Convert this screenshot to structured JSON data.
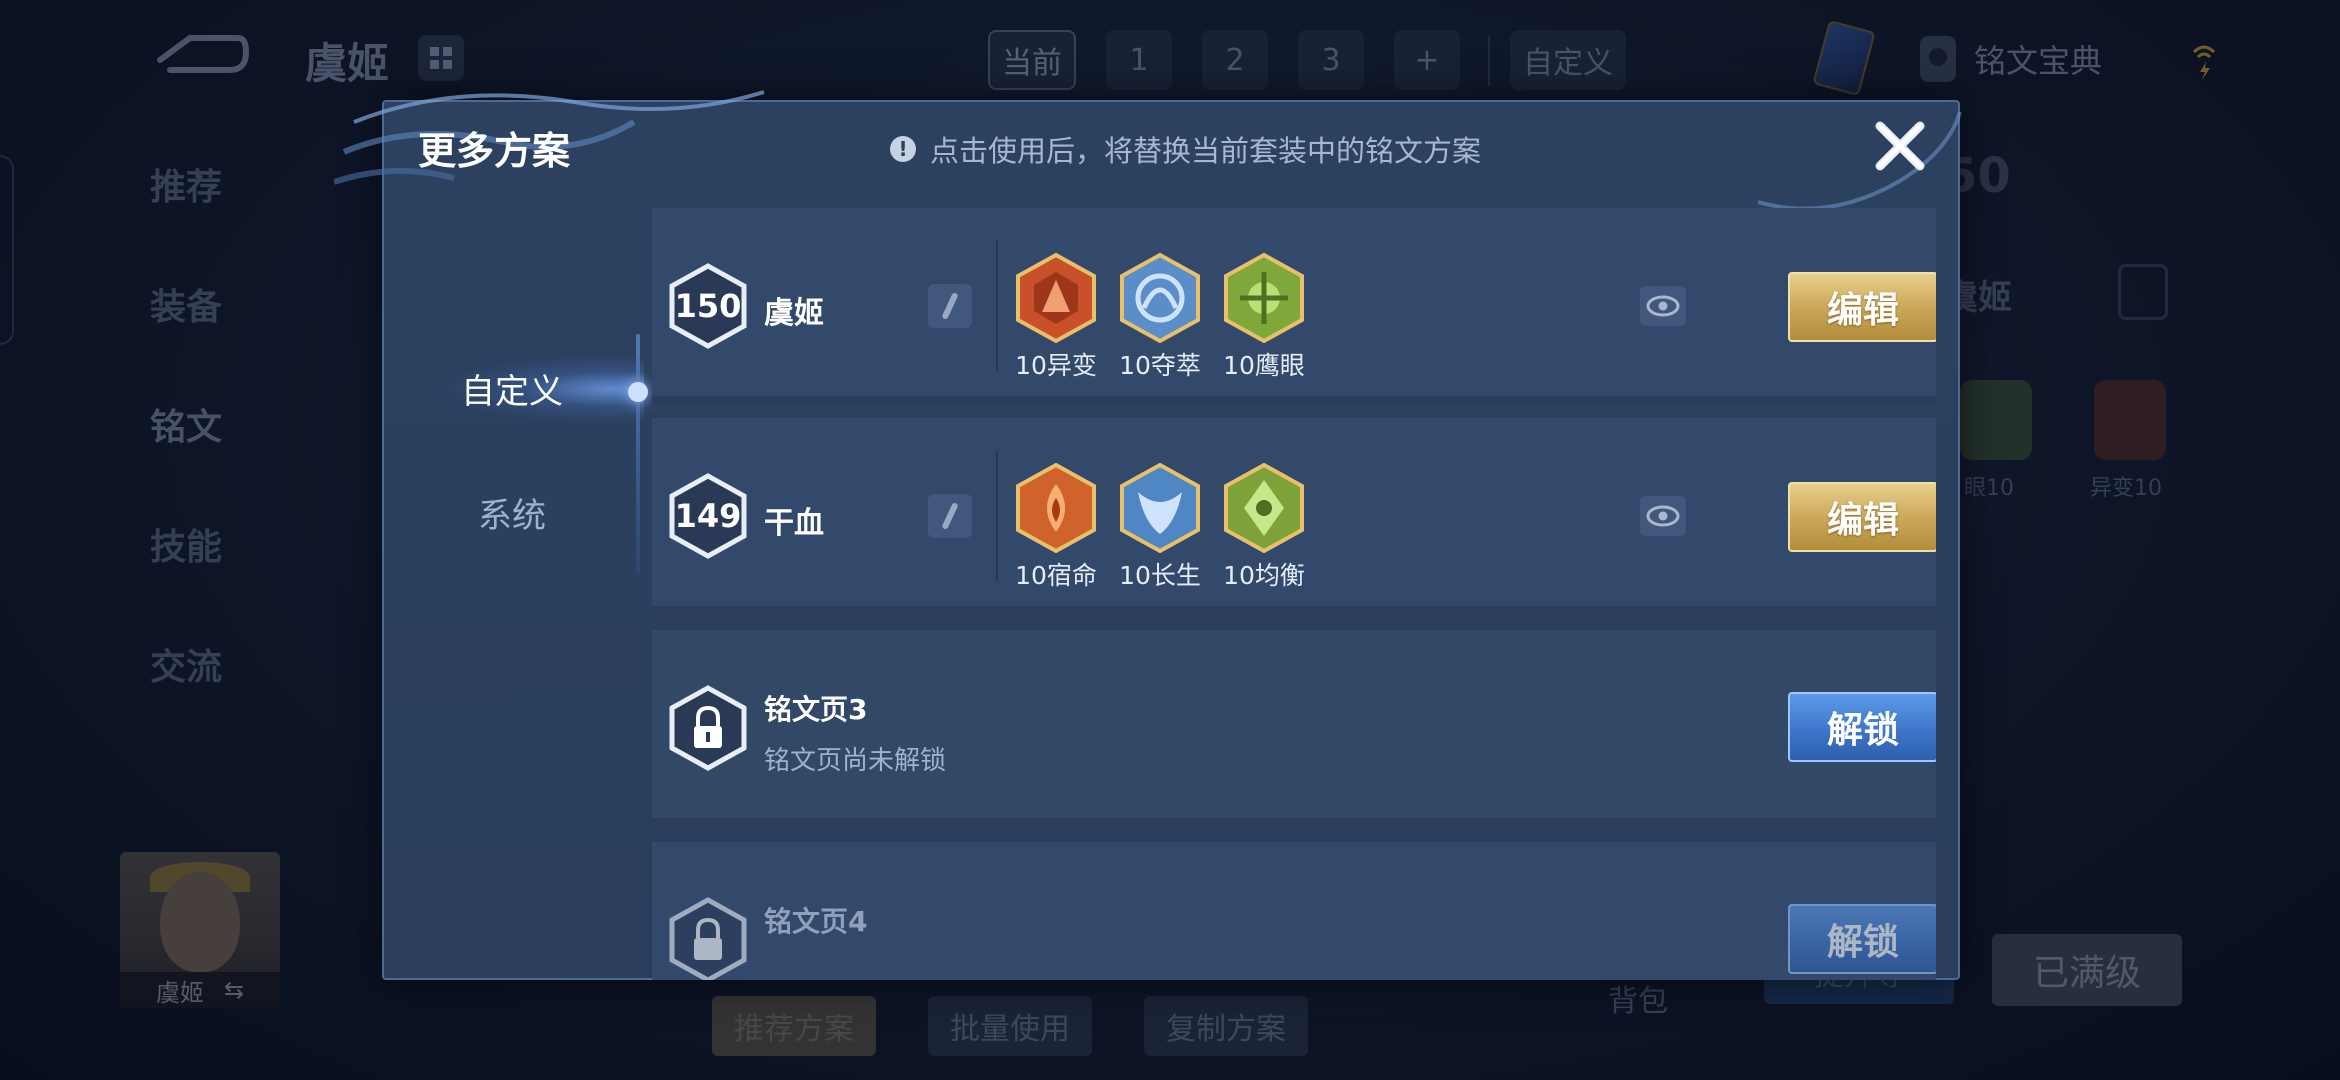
{
  "background": {
    "hero_title": "虞姬",
    "page_tabs": [
      "当前",
      "1",
      "2",
      "3",
      "+",
      "自定义"
    ],
    "codex_label": "铭文宝典",
    "side_nav": [
      "推荐",
      "装备",
      "铭文",
      "技能",
      "交流"
    ],
    "level_label": "50",
    "hero_label": "虞姬",
    "bottom_buttons": [
      "推荐方案",
      "批量使用",
      "复制方案"
    ],
    "bag_label": "背包",
    "upgrade_label": "提升等",
    "maxed_label": "已满级",
    "right_rune_labels": [
      "眼10",
      "异变10"
    ],
    "right_hero_label": "虞姬"
  },
  "modal": {
    "title": "更多方案",
    "notice": "点击使用后，将替换当前套装中的铭文方案",
    "tabs": [
      {
        "label": "自定义",
        "active": true
      },
      {
        "label": "系统",
        "active": false
      }
    ],
    "rows": [
      {
        "level": "150",
        "name": "虞姬",
        "runes": [
          {
            "label": "10异变",
            "color": "#c8502a"
          },
          {
            "label": "10夺萃",
            "color": "#5b8dc8"
          },
          {
            "label": "10鹰眼",
            "color": "#7fa83a"
          }
        ],
        "button": "编辑"
      },
      {
        "level": "149",
        "name": "干血",
        "runes": [
          {
            "label": "10宿命",
            "color": "#d0622c"
          },
          {
            "label": "10长生",
            "color": "#4f86c4"
          },
          {
            "label": "10均衡",
            "color": "#7ea23a"
          }
        ],
        "button": "编辑"
      },
      {
        "title": "铭文页3",
        "subtitle": "铭文页尚未解锁",
        "button": "解锁"
      },
      {
        "title": "铭文页4",
        "button": "解锁"
      }
    ]
  },
  "colors": {
    "modal_bg": "#2c4160",
    "row_bg": "#33496b",
    "edit_gold": "#c9a556",
    "unlock_blue": "#3c73c7"
  }
}
